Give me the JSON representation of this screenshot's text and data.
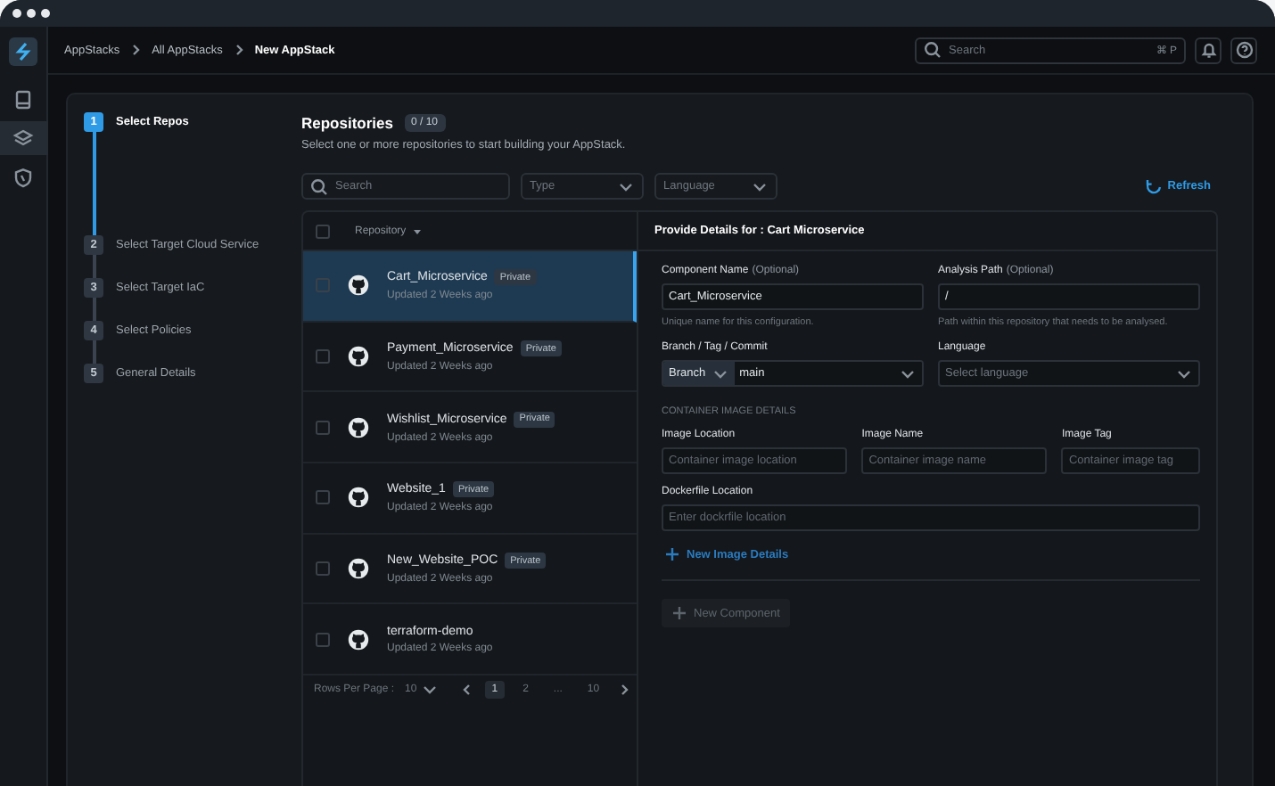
{
  "breadcrumbs": [
    "AppStacks",
    "All AppStacks",
    "New AppStack"
  ],
  "top_search": {
    "placeholder": "Search",
    "shortcut": "⌘ P"
  },
  "rail": [
    {
      "kind": "device",
      "selected": false
    },
    {
      "kind": "layers",
      "selected": true
    },
    {
      "kind": "shield",
      "selected": false
    }
  ],
  "steps": [
    {
      "number": "1",
      "label": "Select Repos",
      "selected": true
    },
    {
      "number": "2",
      "label": "Select Target Cloud Service",
      "selected": false
    },
    {
      "number": "3",
      "label": "Select Target IaC",
      "selected": false
    },
    {
      "number": "4",
      "label": "Select Policies",
      "selected": false
    },
    {
      "number": "5",
      "label": "General Details",
      "selected": false
    }
  ],
  "repositories": {
    "title": "Repositories",
    "count": "0 / 10",
    "subtitle": "Select one or more repositories to start building your AppStack.",
    "search_placeholder": "Search",
    "select_all": {
      "checked": false
    },
    "filters": [
      "Type",
      "Language"
    ],
    "refresh": "Refresh",
    "column": "Repository",
    "rows": [
      {
        "name": "Cart_Microservice",
        "badge": "Private",
        "updated": "Updated 2 Weeks ago",
        "checked": false,
        "selected": true
      },
      {
        "name": "Payment_Microservice",
        "badge": "Private",
        "updated": "Updated 2 Weeks ago",
        "checked": false,
        "selected": false
      },
      {
        "name": "Wishlist_Microservice",
        "badge": "Private",
        "updated": "Updated 2 Weeks ago",
        "checked": false,
        "selected": false
      },
      {
        "name": "Website_1",
        "badge": "Private",
        "updated": "Updated 2 Weeks ago",
        "checked": false,
        "selected": false
      },
      {
        "name": "New_Website_POC",
        "badge": "Private",
        "updated": "Updated 2 Weeks ago",
        "checked": false,
        "selected": false
      },
      {
        "name": "terraform-demo",
        "updated": "Updated 2 Weeks ago",
        "checked": false,
        "selected": false
      }
    ],
    "pagination": {
      "rows_label": "Rows Per Page :",
      "rows_value": "10",
      "pages": [
        {
          "label": "1",
          "selected": true
        },
        {
          "label": "2",
          "selected": false
        },
        {
          "label": "...",
          "selected": false
        },
        {
          "label": "10",
          "selected": false
        }
      ]
    }
  },
  "details": {
    "title": "Provide Details for : Cart Microservice",
    "component_name": {
      "label": "Component Name",
      "optional": "(Optional)",
      "value": "Cart_Microservice",
      "hint": "Unique name for this configuration."
    },
    "analysis_path": {
      "label": "Analysis Path",
      "optional": "(Optional)",
      "value": "/",
      "hint": "Path within this repository that needs to be analysed."
    },
    "branch": {
      "label": "Branch / Tag / Commit",
      "type": "Branch",
      "value": "main"
    },
    "language": {
      "label": "Language",
      "placeholder": "Select language"
    },
    "section": "CONTAINER IMAGE DETAILS",
    "image_fields": [
      {
        "label": "Image Location",
        "placeholder": "Container image location"
      },
      {
        "label": "Image Name",
        "placeholder": "Container image name"
      },
      {
        "label": "Image Tag",
        "placeholder": "Container image tag"
      }
    ],
    "dockerfile": {
      "label": "Dockerfile Location",
      "placeholder": "Enter dockrfile location"
    },
    "new_image": "New Image Details",
    "new_component": "New Component"
  }
}
